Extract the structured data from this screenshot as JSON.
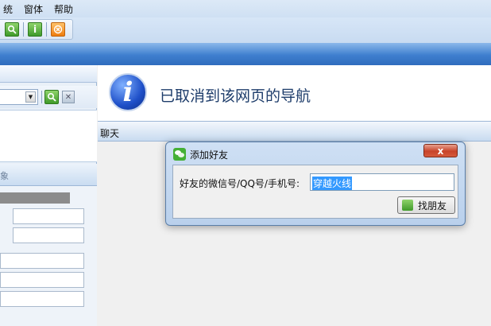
{
  "menu": {
    "items": [
      "统",
      "窗体",
      "帮助"
    ]
  },
  "navigation": {
    "message": "已取消到该网页的导航"
  },
  "chat": {
    "label": "聊天"
  },
  "left_panel": {
    "tab_label": "象"
  },
  "dialog": {
    "title": "添加好友",
    "close_label": "x",
    "field_label": "好友的微信号/QQ号/手机号:",
    "field_value": "穿越火线",
    "button_label": "找朋友"
  },
  "colors": {
    "title_band": "#3f7fcf",
    "selection": "#3399ff",
    "close": "#c8442a"
  }
}
